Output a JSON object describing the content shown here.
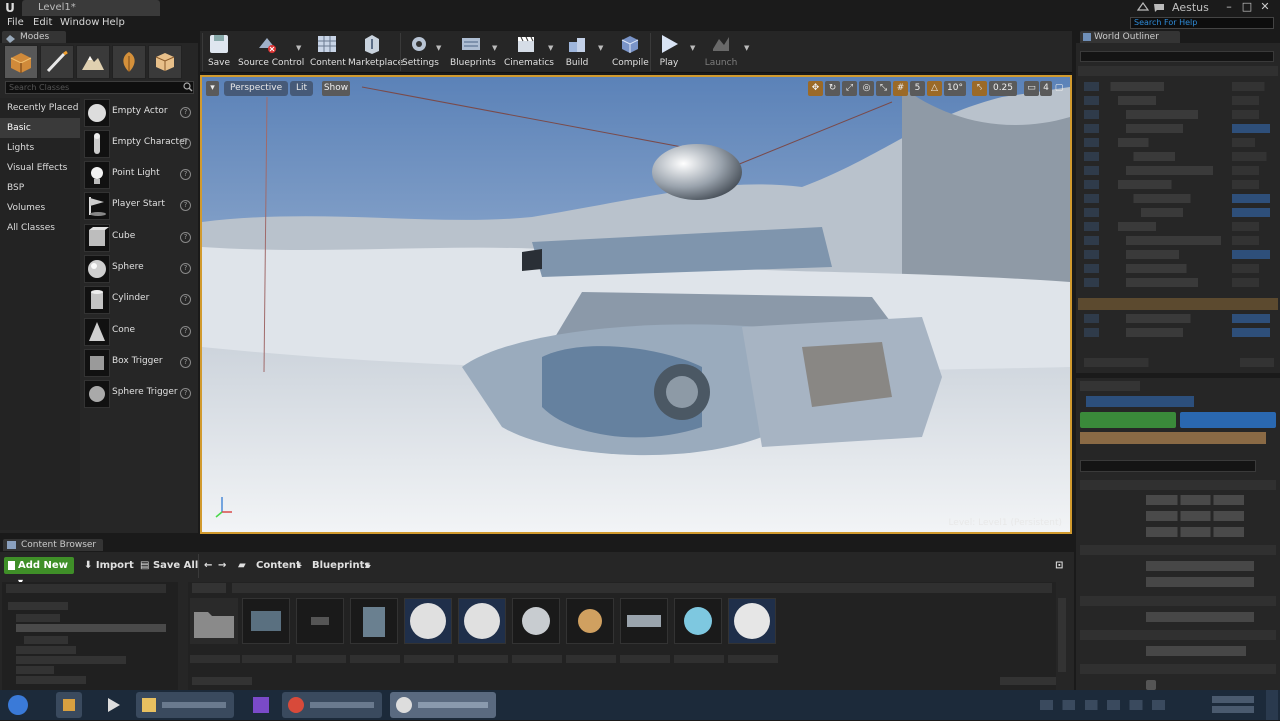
{
  "window": {
    "doc_tab": "Level1*",
    "brand": "Aestus",
    "help_search_placeholder": "Search For Help"
  },
  "menu": [
    "File",
    "Edit",
    "Window",
    "Help"
  ],
  "modes": {
    "tab_label": "Modes",
    "search_placeholder": "Search Classes",
    "categories": [
      "Recently Placed",
      "Basic",
      "Lights",
      "Visual Effects",
      "BSP",
      "Volumes",
      "All Classes"
    ],
    "active_category": "Basic",
    "items": [
      "Empty Actor",
      "Empty Character",
      "Point Light",
      "Player Start",
      "Cube",
      "Sphere",
      "Cylinder",
      "Cone",
      "Box Trigger",
      "Sphere Trigger"
    ]
  },
  "toolbar": {
    "save": "Save",
    "source_control": "Source Control",
    "content": "Content",
    "marketplace": "Marketplace",
    "settings": "Settings",
    "blueprints": "Blueprints",
    "cinematics": "Cinematics",
    "build": "Build",
    "compile": "Compile",
    "play": "Play",
    "launch": "Launch"
  },
  "viewport": {
    "perspective": "Perspective",
    "lit": "Lit",
    "show": "Show",
    "grid_snap": "5",
    "rot_snap": "10°",
    "scale_snap": "0.25",
    "cam_speed": "4",
    "level_label": "Level:  Level1 (Persistent)"
  },
  "outliner": {
    "tab_label": "World Outliner"
  },
  "content_browser": {
    "tab_label": "Content Browser",
    "add_new": "Add New",
    "import": "Import",
    "save_all": "Save All",
    "path": [
      "Content",
      "Blueprints"
    ]
  },
  "colors": {
    "accent_orange": "#d19a2e",
    "add_new_green": "#3f8f28",
    "selected_blue": "#465a78"
  }
}
